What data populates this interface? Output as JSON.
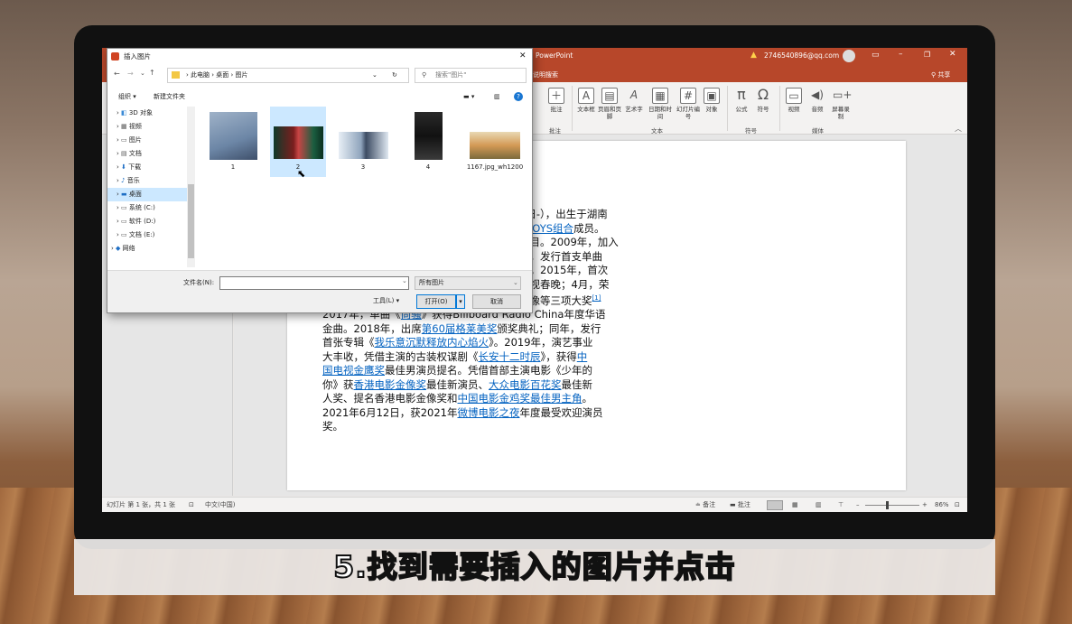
{
  "powerpoint": {
    "app_title": "PowerPoint",
    "account": "2746540896@qq.com",
    "share_label": "共享",
    "tell_me": "说明搜索",
    "ribbon": {
      "buttons": [
        "批注",
        "文本框",
        "页眉和页脚",
        "艺术字",
        "日期和时间",
        "幻灯片编号",
        "对象",
        "公式",
        "符号",
        "视频",
        "音频",
        "屏幕录制"
      ],
      "groups": [
        "批注",
        "文本",
        "符号",
        "媒体"
      ]
    },
    "slide_text": {
      "l1": "3日-），出生于湖南",
      "l2_link": "FBOYS组合",
      "l2_tail": "成员。",
      "l3": "节目。2009年，加入",
      "l4": "月，发行首支单曲",
      "l5": "合。2015年，首次",
      "l6": "央视春晚；4月，荣",
      "l7": "偶像等三项大奖",
      "l7_sup": "[1]",
      "l8_a": "2017年，单曲《",
      "l8_link": "尚骚",
      "l8_b": "》获得Billboard Radio China年度华语",
      "l9": "金曲。2018年，出席",
      "l9_link": "第60届格莱美奖",
      "l9_b": "颁奖典礼；同年，发行",
      "l10_a": "首张专辑《",
      "l10_link": "我乐意沉默释放内心焰火",
      "l10_b": "》。2019年，演艺事业",
      "l11_a": "大丰收，凭借主演的古装权谋剧《",
      "l11_link": "长安十二时辰",
      "l11_b": "》，获得",
      "l11_link2": "中",
      "l12_link": "国电视金鹰奖",
      "l12_b": "最佳男演员提名。凭借首部主演电影《少年的",
      "l13_a": "你》获",
      "l13_link": "香港电影金像奖",
      "l13_b": "最佳新演员、",
      "l13_link2": "大众电影百花奖",
      "l13_c": "最佳新",
      "l14_a": "人奖、提名香港电影金像奖和",
      "l14_link": "中国电影金鸡奖最佳男主角",
      "l14_b": "。",
      "l15_a": "2021年6月12日，获2021年",
      "l15_link": "微博电影之夜",
      "l15_b": "年度最受欢迎演员",
      "l16": "奖。"
    },
    "status": {
      "slide_info": "幻灯片 第 1 张，共 1 张",
      "language": "中文(中国)",
      "notes": "备注",
      "comments": "批注",
      "zoom": "86%"
    }
  },
  "dialog": {
    "title": "插入图片",
    "breadcrumb": [
      "此电脑",
      "桌面",
      "图片"
    ],
    "search_placeholder": "搜索\"图片\"",
    "organize": "组织 ▾",
    "new_folder": "新建文件夹",
    "nav_items": [
      "3D 对象",
      "视频",
      "图片",
      "文档",
      "下载",
      "音乐",
      "桌面",
      "系统 (C:)",
      "软件 (D:)",
      "文档 (E:)",
      "网络"
    ],
    "files": [
      {
        "name": "1"
      },
      {
        "name": "2"
      },
      {
        "name": "3"
      },
      {
        "name": "4"
      },
      {
        "name": "1167.jpg_wh1200"
      }
    ],
    "filename_label": "文件名(N):",
    "filename_value": "",
    "filetype": "所有图片",
    "tools": "工具(L)",
    "open": "打开(O)",
    "cancel": "取消"
  },
  "caption": "5.找到需要插入的图片并点击",
  "colors": {
    "ppt_accent": "#b7472a",
    "selection": "#cce8ff",
    "link": "#0563c1"
  }
}
